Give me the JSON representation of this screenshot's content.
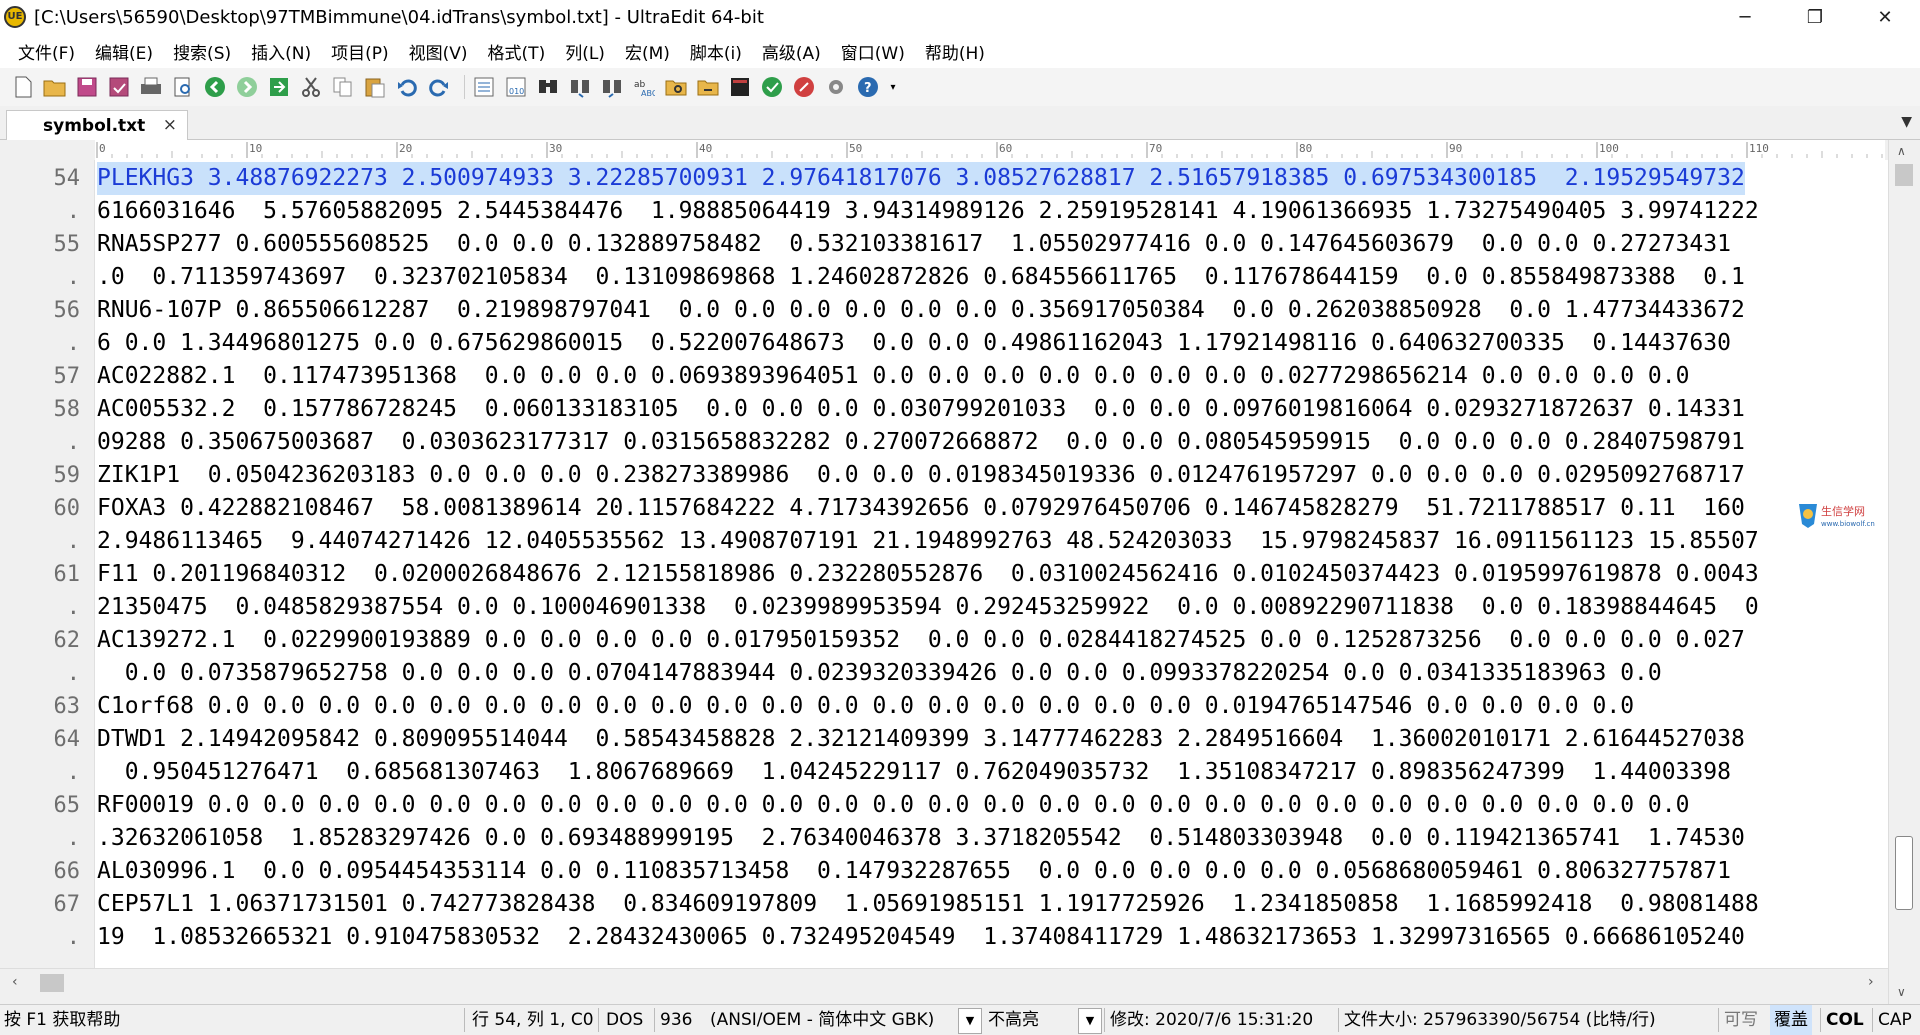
{
  "window": {
    "title": "[C:\\Users\\56590\\Desktop\\97TMBimmune\\04.idTrans\\symbol.txt] - UltraEdit 64-bit",
    "minimize": "─",
    "maximize": "❐",
    "close": "✕"
  },
  "menu": [
    "文件(F)",
    "编辑(E)",
    "搜索(S)",
    "插入(N)",
    "项目(P)",
    "视图(V)",
    "格式(T)",
    "列(L)",
    "宏(M)",
    "脚本(i)",
    "高级(A)",
    "窗口(W)",
    "帮助(H)"
  ],
  "toolbar_icons": [
    "new-file-icon",
    "open-folder-icon",
    "save-icon",
    "save-all-icon",
    "print-icon",
    "print-preview-icon",
    "back-icon",
    "forward-icon",
    "goto-icon",
    "cut-icon",
    "copy-icon",
    "paste-icon",
    "undo-icon",
    "redo-icon",
    "hex-edit-icon",
    "binary-icon",
    "find-icon",
    "find-next-icon",
    "find-prev-icon",
    "spellcheck-icon",
    "find-files-icon",
    "replace-files-icon",
    "terminal-icon",
    "run-icon",
    "stop-icon",
    "settings-icon",
    "help-icon"
  ],
  "tab": {
    "label": "symbol.txt",
    "close": "×"
  },
  "ruler": {
    "ticks": [
      "0",
      "10",
      "20",
      "30",
      "40",
      "50",
      "60",
      "70",
      "80",
      "90",
      "100",
      "110"
    ]
  },
  "lines": [
    {
      "num": "54",
      "text": "PLEKHG3 3.48876922273 2.500974933 3.22285700931 2.97641817076 3.08527628817 2.51657918385 0.697534300185  2.19529549732",
      "selected": true
    },
    {
      "num": ".",
      "text": "6166031646  5.57605882095 2.5445384476  1.98885064419 3.94314989126 2.25919528141 4.19061366935 1.73275490405 3.99741222"
    },
    {
      "num": "55",
      "text": "RNA5SP277 0.600555608525  0.0 0.0 0.132889758482  0.532103381617  1.05502977416 0.0 0.147645603679  0.0 0.0 0.27273431"
    },
    {
      "num": ".",
      "text": ".0  0.711359743697  0.323702105834  0.13109869868 1.24602872826 0.684556611765  0.117678644159  0.0 0.855849873388  0.1"
    },
    {
      "num": "56",
      "text": "RNU6-107P 0.865506612287  0.219898797041  0.0 0.0 0.0 0.0 0.0 0.0 0.356917050384  0.0 0.262038850928  0.0 1.47734433672"
    },
    {
      "num": ".",
      "text": "6 0.0 1.34496801275 0.0 0.675629860015  0.522007648673  0.0 0.0 0.49861162043 1.17921498116 0.640632700335  0.14437630"
    },
    {
      "num": "57",
      "text": "AC022882.1  0.117473951368  0.0 0.0 0.0 0.0693893964051 0.0 0.0 0.0 0.0 0.0 0.0 0.0 0.0277298656214 0.0 0.0 0.0 0.0"
    },
    {
      "num": "58",
      "text": "AC005532.2  0.157786728245  0.060133183105  0.0 0.0 0.0 0.030799201033  0.0 0.0 0.0976019816064 0.0293271872637 0.14331"
    },
    {
      "num": ".",
      "text": "09288 0.350675003687  0.0303623177317 0.0315658832282 0.270072668872  0.0 0.0 0.080545959915  0.0 0.0 0.0 0.28407598791"
    },
    {
      "num": "59",
      "text": "ZIK1P1  0.0504236203183 0.0 0.0 0.0 0.238273389986  0.0 0.0 0.0198345019336 0.0124761957297 0.0 0.0 0.0 0.0295092768717"
    },
    {
      "num": "60",
      "text": "FOXA3 0.422882108467  58.0081389614 20.1157684222 4.71734392656 0.0792976450706 0.146745828279  51.7211788517 0.11  160"
    },
    {
      "num": ".",
      "text": "2.9486113465  9.44074271426 12.0405535562 13.4908707191 21.1948992763 48.524203033  15.9798245837 16.0911561123 15.85507"
    },
    {
      "num": "61",
      "text": "F11 0.201196840312  0.0200026848676 2.12155818986 0.232280552876  0.0310024562416 0.0102450374423 0.0195997619878 0.0043"
    },
    {
      "num": ".",
      "text": "21350475  0.0485829387554 0.0 0.100046901338  0.0239989953594 0.292453259922  0.0 0.00892290711838  0.0 0.18398844645  0"
    },
    {
      "num": "62",
      "text": "AC139272.1  0.0229900193889 0.0 0.0 0.0 0.0 0.017950159352  0.0 0.0 0.0284418274525 0.0 0.1252873256  0.0 0.0 0.0 0.027"
    },
    {
      "num": ".",
      "text": "  0.0 0.0735879652758 0.0 0.0 0.0 0.0704147883944 0.0239320339426 0.0 0.0 0.0993378220254 0.0 0.0341335183963 0.0"
    },
    {
      "num": "63",
      "text": "C1orf68 0.0 0.0 0.0 0.0 0.0 0.0 0.0 0.0 0.0 0.0 0.0 0.0 0.0 0.0 0.0 0.0 0.0 0.0 0.0194765147546 0.0 0.0 0.0 0.0"
    },
    {
      "num": "64",
      "text": "DTWD1 2.14942095842 0.809095514044  0.58543458828 2.32121409399 3.14777462283 2.2849516604  1.36002010171 2.61644527038"
    },
    {
      "num": ".",
      "text": "  0.950451276471  0.685681307463  1.8067689669  1.04245229117 0.762049035732  1.35108347217 0.898356247399  1.44003398"
    },
    {
      "num": "65",
      "text": "RF00019 0.0 0.0 0.0 0.0 0.0 0.0 0.0 0.0 0.0 0.0 0.0 0.0 0.0 0.0 0.0 0.0 0.0 0.0 0.0 0.0 0.0 0.0 0.0 0.0 0.0 0.0 0.0"
    },
    {
      "num": ".",
      "text": ".32632061058  1.85283297426 0.0 0.693488999195  2.76340046378 3.3718205542  0.514803303948  0.0 0.119421365741  1.74530"
    },
    {
      "num": "66",
      "text": "AL030996.1  0.0 0.0954454353114 0.0 0.110835713458  0.147932287655  0.0 0.0 0.0 0.0 0.0 0.0568680059461 0.806327757871"
    },
    {
      "num": "67",
      "text": "CEP57L1 1.06371731501 0.742773828438  0.834609197809  1.05691985151 1.1917725926  1.2341850858  1.1685992418  0.98081488"
    },
    {
      "num": ".",
      "text": "19  1.08532665321 0.910475830532  2.28432430065 0.732495204549  1.37408411729 1.48632173653 1.32997316565 0.66686105240"
    }
  ],
  "statusbar": {
    "help": "按 F1 获取帮助",
    "position": "行 54, 列 1, C0",
    "line_ending": "DOS",
    "codepage": "936",
    "encoding": "(ANSI/OEM - 简体中文 GBK)",
    "highlight": "不高亮",
    "modified": "修改:  2020/7/6 15:31:20",
    "filesize": "文件大小:  257963390/56754  (比特/行)",
    "writable": "可写",
    "insert_mode": "覆盖",
    "col": "COL",
    "cap": "CAP"
  },
  "colors": {
    "selection_bg": "#c9e1fb",
    "selection_text": "#1b3bd6",
    "mode_highlight": "#cfe3fb"
  }
}
